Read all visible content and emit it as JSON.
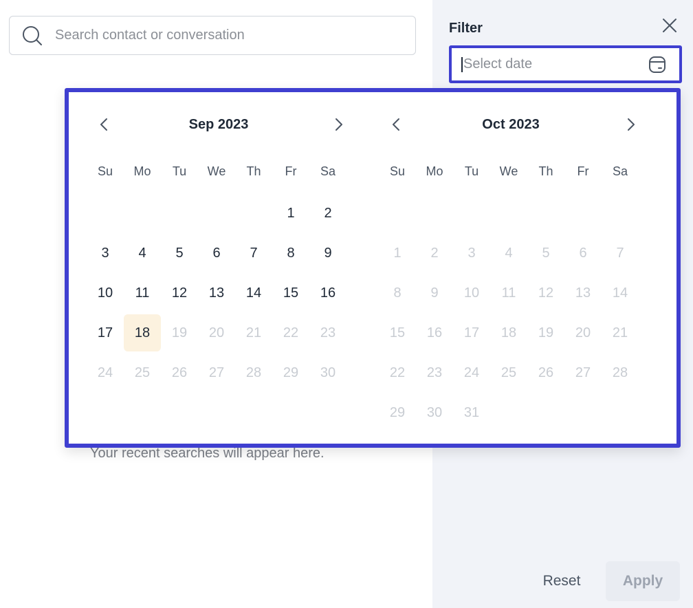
{
  "search": {
    "placeholder": "Search contact or conversation",
    "value": ""
  },
  "recent_text": "Your recent searches will appear here.",
  "filter": {
    "title": "Filter",
    "date_placeholder": "Select date",
    "reset_label": "Reset",
    "apply_label": "Apply"
  },
  "calendar": {
    "weekdays": [
      "Su",
      "Mo",
      "Tu",
      "We",
      "Th",
      "Fr",
      "Sa"
    ],
    "months": [
      {
        "title": "Sep 2023",
        "leading_blanks": 5,
        "days": [
          "1",
          "2",
          "3",
          "4",
          "5",
          "6",
          "7",
          "8",
          "9",
          "10",
          "11",
          "12",
          "13",
          "14",
          "15",
          "16",
          "17",
          "18",
          "19",
          "20",
          "21",
          "22",
          "23",
          "24",
          "25",
          "26",
          "27",
          "28",
          "29",
          "30"
        ],
        "enabled_through": 18,
        "today": 18
      },
      {
        "title": "Oct 2023",
        "leading_blanks": 7,
        "days": [
          "1",
          "2",
          "3",
          "4",
          "5",
          "6",
          "7",
          "8",
          "9",
          "10",
          "11",
          "12",
          "13",
          "14",
          "15",
          "16",
          "17",
          "18",
          "19",
          "20",
          "21",
          "22",
          "23",
          "24",
          "25",
          "26",
          "27",
          "28",
          "29",
          "30",
          "31"
        ],
        "enabled_through": 0,
        "today": null
      }
    ]
  },
  "colors": {
    "accent_border": "#3f3fd0",
    "today_bg": "#fcf2df",
    "filter_bg": "#f1f3f8",
    "disabled_text": "#c8ccd2"
  },
  "icons": {
    "search": "search-icon",
    "close": "close-icon",
    "calendar": "calendar-icon",
    "prev": "chevron-left-icon",
    "next": "chevron-right-icon"
  }
}
